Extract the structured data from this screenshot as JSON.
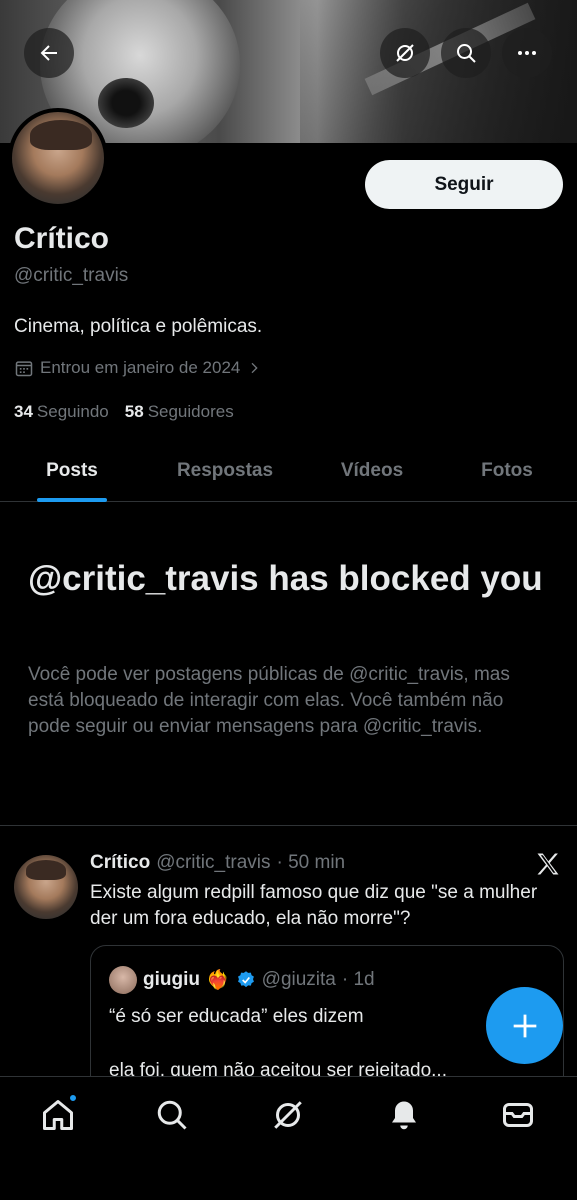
{
  "header": {
    "back_icon": "arrow-left-icon",
    "grok_icon": "grok-icon",
    "search_icon": "search-icon",
    "more_icon": "more-icon"
  },
  "profile": {
    "follow_label": "Seguir",
    "name": "Crítico",
    "handle": "@critic_travis",
    "bio": "Cinema, política e polêmicas.",
    "joined": "Entrou em janeiro de 2024",
    "following_count": "34",
    "following_label": "Seguindo",
    "followers_count": "58",
    "followers_label": "Seguidores"
  },
  "tabs": [
    {
      "label": "Posts",
      "active": true
    },
    {
      "label": "Respostas",
      "active": false
    },
    {
      "label": "Vídeos",
      "active": false
    },
    {
      "label": "Fotos",
      "active": false
    }
  ],
  "blocked": {
    "title": "@critic_travis has blocked you",
    "text": "Você pode ver postagens públicas de @critic_travis, mas está bloqueado de interagir com elas. Você também não pode seguir ou enviar mensagens para @critic_travis."
  },
  "tweet": {
    "name": "Crítico",
    "handle": "@critic_travis",
    "time": "· 50 min",
    "text": "Existe algum redpill famoso que diz que \"se a mulher der um fora educado, ela não morre\"?",
    "quote": {
      "name": "giugiu",
      "emoji": "❤️‍🔥",
      "handle": "@giuzita",
      "time": "· 1d",
      "line1": "“é só ser educada” eles dizem",
      "line2": "ela foi, quem não aceitou ser rejeitado..."
    }
  },
  "colors": {
    "accent": "#1d9bf0",
    "text": "#e7e9ea",
    "muted": "#71767b",
    "background": "#000000"
  }
}
